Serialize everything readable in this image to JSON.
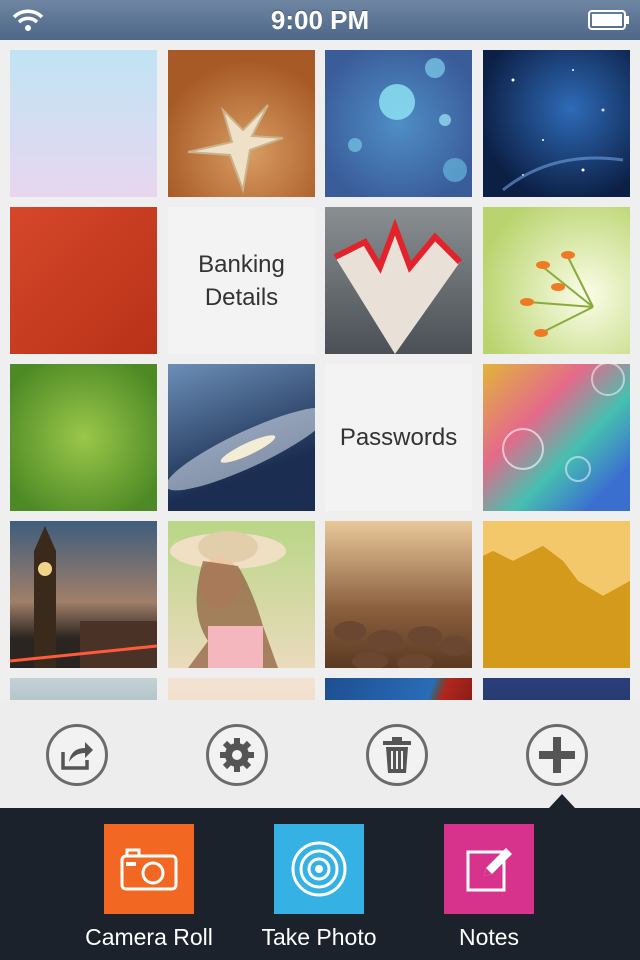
{
  "status_bar": {
    "time": "9:00 PM",
    "wifi_icon": "wifi-icon",
    "battery_icon": "battery-icon"
  },
  "grid": {
    "label_tiles": [
      "Banking\nDetails",
      "Passwords"
    ]
  },
  "toolbar": {
    "buttons": [
      {
        "name": "share-button",
        "icon": "share-icon"
      },
      {
        "name": "settings-button",
        "icon": "gear-icon"
      },
      {
        "name": "delete-button",
        "icon": "trash-icon"
      },
      {
        "name": "add-button",
        "icon": "plus-icon"
      }
    ]
  },
  "actions": [
    {
      "label": "Camera Roll",
      "icon": "camera-icon",
      "color": "#f26722"
    },
    {
      "label": "Take Photo",
      "icon": "lens-icon",
      "color": "#35b2e3"
    },
    {
      "label": "Notes",
      "icon": "edit-icon",
      "color": "#d7338d"
    }
  ]
}
